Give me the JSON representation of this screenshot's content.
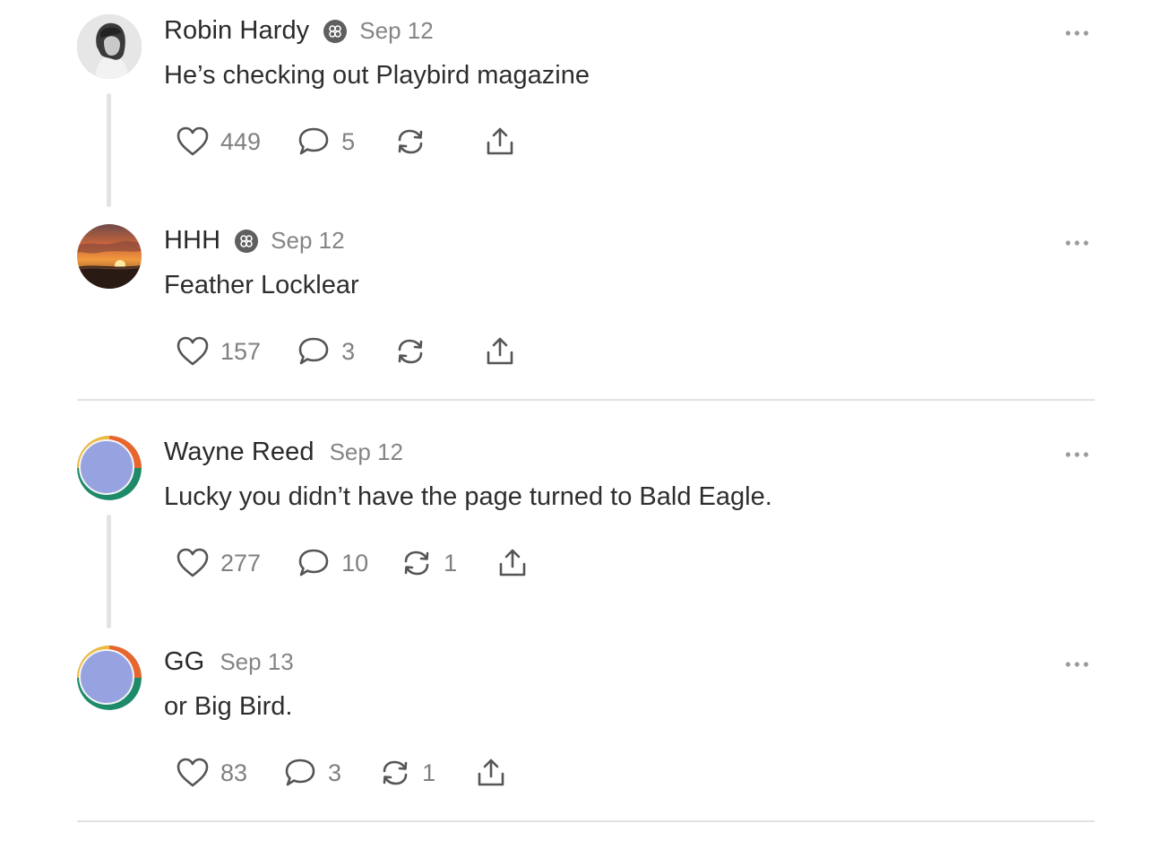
{
  "posts": [
    {
      "name": "Robin Hardy",
      "verified": true,
      "date": "Sep 12",
      "text": "He’s checking out Playbird magazine",
      "likes": "449",
      "replies": "5",
      "reposts": "",
      "avatar": "person-photo"
    },
    {
      "name": "HHH",
      "verified": true,
      "date": "Sep 12",
      "text": "Feather Locklear",
      "likes": "157",
      "replies": "3",
      "reposts": "",
      "avatar": "sunset-photo"
    },
    {
      "name": "Wayne Reed",
      "verified": false,
      "date": "Sep 12",
      "text": "Lucky you didn’t have the page turned to Bald Eagle.",
      "likes": "277",
      "replies": "10",
      "reposts": "1",
      "avatar": "default-avatar"
    },
    {
      "name": "GG",
      "verified": false,
      "date": "Sep 13",
      "text": "or Big Bird.",
      "likes": "83",
      "replies": "3",
      "reposts": "1",
      "avatar": "default-avatar"
    }
  ],
  "icons": {
    "like": "heart-icon",
    "reply": "speech-bubble-icon",
    "repost": "repost-arrows-icon",
    "share": "share-upload-icon",
    "more": "ellipsis-icon",
    "badge": "flower-badge-icon"
  },
  "colors": {
    "text": "#2b2b2b",
    "muted": "#808080",
    "divider": "#e2e2e2",
    "icon": "#555555"
  }
}
